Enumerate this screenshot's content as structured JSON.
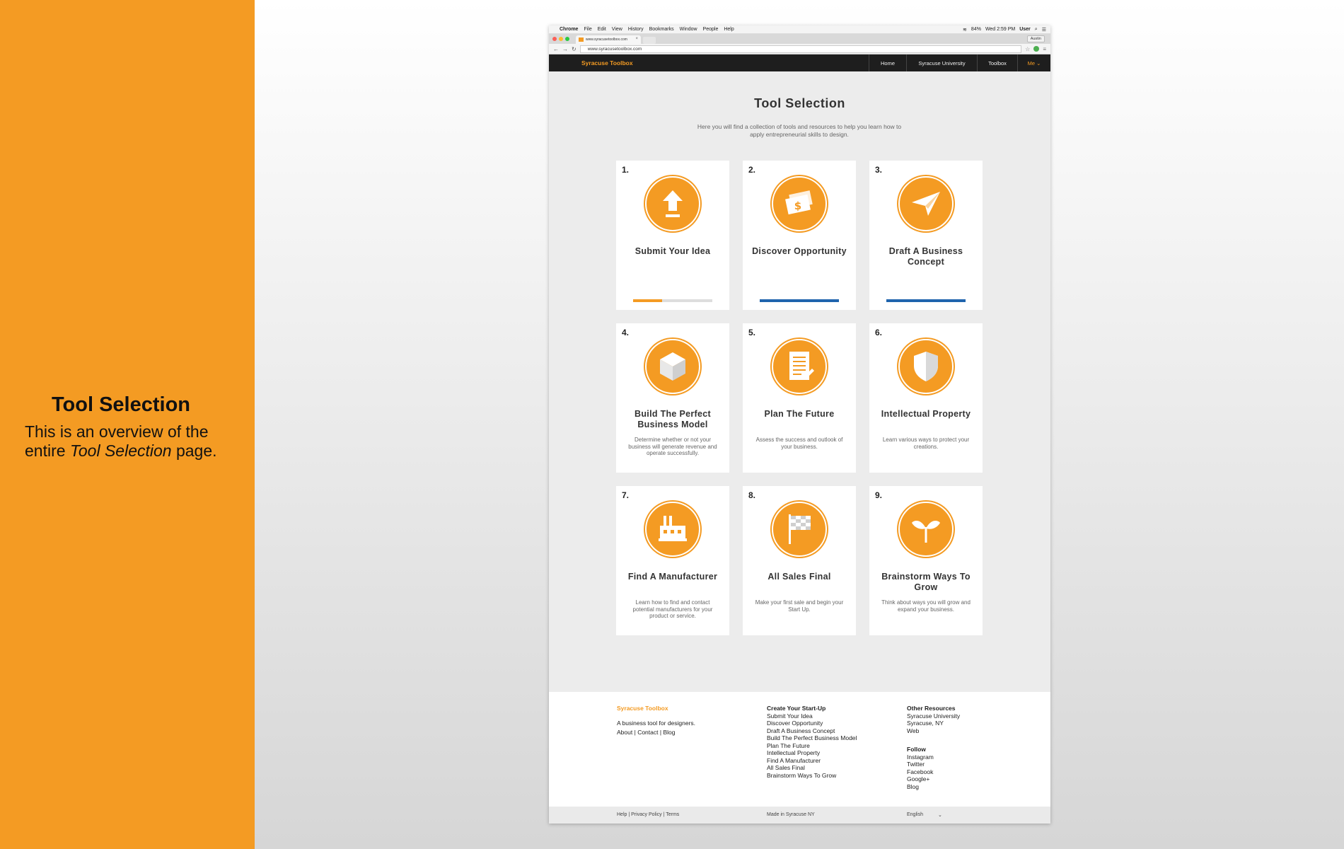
{
  "side": {
    "title": "Tool Selection",
    "desc_prefix": "This is an overview of the entire ",
    "desc_italic": "Tool Selection",
    "desc_suffix": " page."
  },
  "menubar": {
    "app": "Chrome",
    "items": [
      "File",
      "Edit",
      "View",
      "History",
      "Bookmarks",
      "Window",
      "People",
      "Help"
    ],
    "battery": "84%",
    "clock": "Wed 2:59 PM",
    "user": "User"
  },
  "browser": {
    "tab_title": "www.syracusetoolbox.com",
    "tab_close": "×",
    "profile": "Austin",
    "url": "www.syracusetoolbox.com"
  },
  "topnav": {
    "brand": "Syracuse Toolbox",
    "links": [
      "Home",
      "Syracuse University",
      "Toolbox"
    ],
    "me": "Me ⌄"
  },
  "page": {
    "title": "Tool Selection",
    "intro": "Here you will find a collection of tools and resources to help you learn how to apply entrepreneurial skills to design."
  },
  "cards": [
    {
      "num": "1.",
      "name": "Submit Your Idea",
      "sub": "",
      "icon": "upload-arrow-icon",
      "progress": 0.37,
      "bar": "orange"
    },
    {
      "num": "2.",
      "name": "Discover Opportunity",
      "sub": "",
      "icon": "money-icon",
      "progress": 1.0,
      "bar": "blue"
    },
    {
      "num": "3.",
      "name": "Draft A Business Concept",
      "sub": "",
      "icon": "paper-plane-icon",
      "progress": 1.0,
      "bar": "blue"
    },
    {
      "num": "4.",
      "name": "Build The Perfect Business Model",
      "sub": "Determine whether or not your business will generate revenue and operate successfully.",
      "icon": "cube-icon"
    },
    {
      "num": "5.",
      "name": "Plan The Future",
      "sub": "Assess the success and outlook of your business.",
      "icon": "document-icon"
    },
    {
      "num": "6.",
      "name": "Intellectual Property",
      "sub": "Learn various ways to protect your creations.",
      "icon": "shield-icon"
    },
    {
      "num": "7.",
      "name": "Find A Manufacturer",
      "sub": "Learn how to find and contact potential manufacturers for your product or service.",
      "icon": "factory-icon"
    },
    {
      "num": "8.",
      "name": "All Sales Final",
      "sub": "Make your first sale and begin your Start Up.",
      "icon": "checkered-flag-icon"
    },
    {
      "num": "9.",
      "name": "Brainstorm Ways To Grow",
      "sub": "Think about ways you will grow and expand your business.",
      "icon": "sprout-icon"
    }
  ],
  "footer": {
    "brand": "Syracuse Toolbox",
    "tagline": "A business tool for designers.",
    "about": "About",
    "contact": "Contact",
    "blog": "Blog",
    "sep": "|",
    "startup_heading": "Create Your Start-Up",
    "startup_links": [
      "Submit Your Idea",
      "Discover Opportunity",
      "Draft A Business Concept",
      "Build The Perfect Business Model",
      "Plan The Future",
      "Intellectual Property",
      "Find A Manufacturer",
      "All Sales Final",
      "Brainstorm Ways To Grow"
    ],
    "resources_heading": "Other Resources",
    "resources": [
      "Syracuse University",
      "Syracuse, NY",
      "Web"
    ],
    "follow_heading": "Follow",
    "follow": [
      "Instagram",
      "Twitter",
      "Facebook",
      "Google+",
      "Blog"
    ],
    "bottom_links": "Help | Privacy Policy | Terms",
    "made_in": "Made in Syracuse NY",
    "language": "English",
    "lang_caret": "⌄"
  },
  "colors": {
    "accent": "#f49b23",
    "blue": "#1f64ad",
    "dark": "#1e1e1e"
  }
}
